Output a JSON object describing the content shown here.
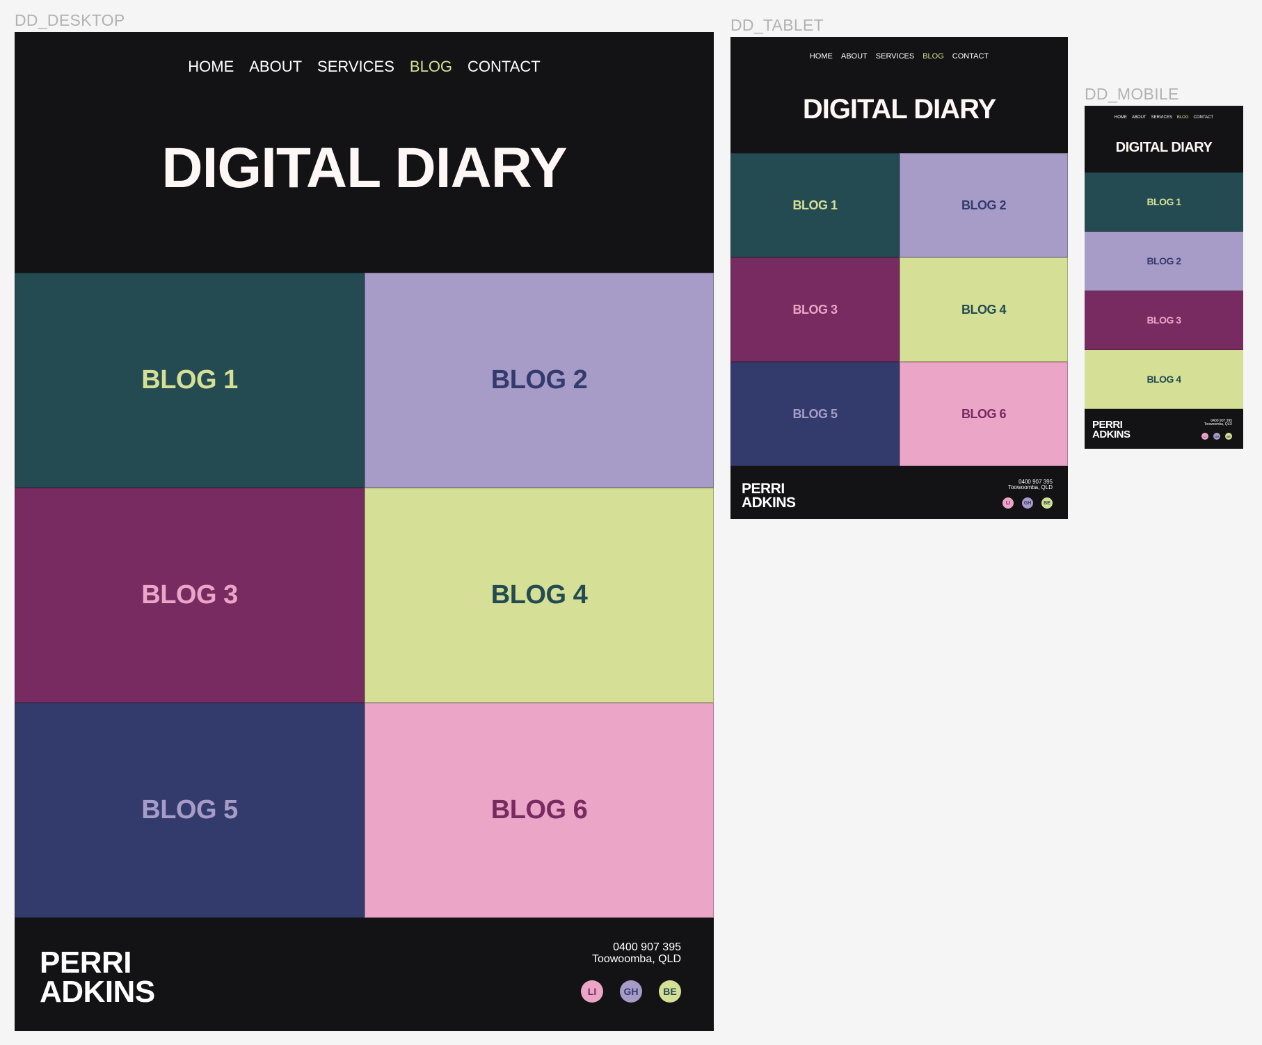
{
  "colors": {
    "canvas": "#f5f5f5",
    "frame_bg": "#131315",
    "heading": "#fff7f5",
    "nav_text": "#ffffff",
    "nav_active": "#d5e096",
    "frame_label": "#b2b2b2"
  },
  "frames": {
    "desktop": {
      "label": "DD_DESKTOP"
    },
    "tablet": {
      "label": "DD_TABLET"
    },
    "mobile": {
      "label": "DD_MOBILE"
    }
  },
  "nav": {
    "items": [
      "HOME",
      "ABOUT",
      "SERVICES",
      "BLOG",
      "CONTACT"
    ],
    "active_index": 3
  },
  "hero": {
    "title": "DIGITAL DIARY"
  },
  "blogs": [
    {
      "label": "BLOG 1",
      "bg": "#244b51",
      "fg": "#d5e096"
    },
    {
      "label": "BLOG 2",
      "bg": "#a79cc8",
      "fg": "#333b6d"
    },
    {
      "label": "BLOG 3",
      "bg": "#772b61",
      "fg": "#eaa5c7"
    },
    {
      "label": "BLOG 4",
      "bg": "#d5e096",
      "fg": "#244b51"
    },
    {
      "label": "BLOG 5",
      "bg": "#333b6d",
      "fg": "#a79cc8"
    },
    {
      "label": "BLOG 6",
      "bg": "#eaa5c7",
      "fg": "#772b61"
    }
  ],
  "footer": {
    "brand_line1": "PERRI",
    "brand_line2": "ADKINS",
    "phone": "0400 907 395",
    "location": "Toowoomba, QLD",
    "socials": [
      {
        "label": "LI",
        "icon": "linkedin-icon",
        "bg": "#eaa5c7",
        "fg": "#772b61"
      },
      {
        "label": "GH",
        "icon": "github-icon",
        "bg": "#a79cc8",
        "fg": "#333b6d"
      },
      {
        "label": "BE",
        "icon": "behance-icon",
        "bg": "#d5e096",
        "fg": "#244b51"
      }
    ]
  }
}
